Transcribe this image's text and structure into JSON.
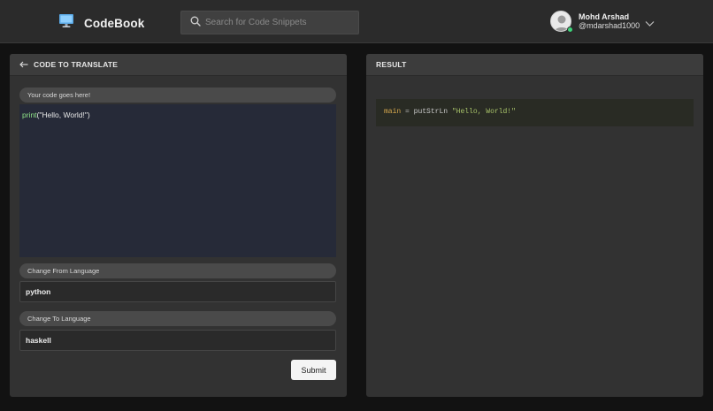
{
  "header": {
    "brand": "CodeBook",
    "search_placeholder": "Search for Code Snippets",
    "user": {
      "name": "Mohd Arshad",
      "handle": "@mdarshad1000"
    }
  },
  "left_panel": {
    "title": "CODE TO TRANSLATE",
    "code_label": "Your code goes here!",
    "code": {
      "fn": "print",
      "args": "(\"Hello, World!\")"
    },
    "from_label": "Change From Language",
    "from_value": "python",
    "to_label": "Change To Language",
    "to_value": "haskell",
    "submit_label": "Submit"
  },
  "right_panel": {
    "title": "RESULT",
    "result": {
      "ident": "main",
      "op": "=",
      "fn": "putStrLn",
      "str": "\"Hello, World!\""
    }
  },
  "colors": {
    "code_fn": "#8fe388",
    "result_ident": "#d8a94e",
    "result_str": "#a9c46a",
    "online": "#3dd47a"
  },
  "icons": [
    "monitor-logo-icon",
    "search-icon",
    "avatar-icon",
    "chevron-down-icon",
    "back-arrow-icon"
  ]
}
